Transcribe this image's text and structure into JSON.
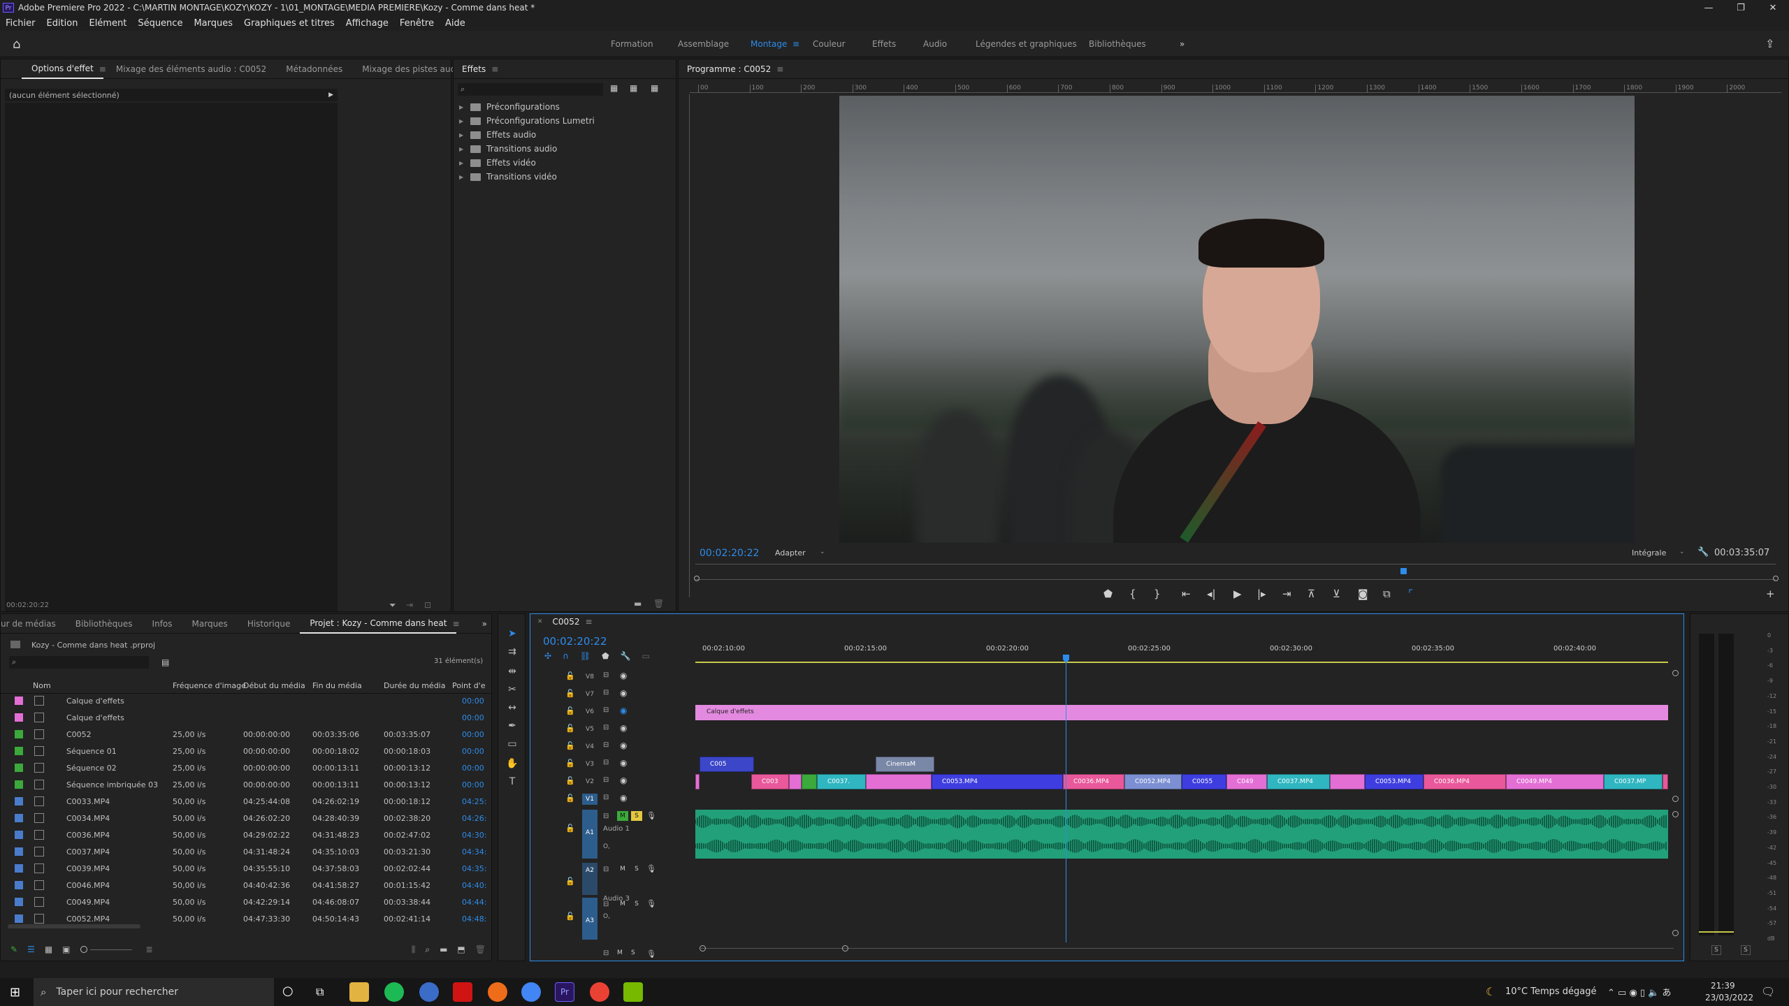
{
  "window": {
    "title": "Adobe Premiere Pro 2022 - C:\\MARTIN MONTAGE\\KOZY\\KOZY - 1\\01_MONTAGE\\MEDIA PREMIERE\\Kozy - Comme dans heat *",
    "app_icon": "Pr"
  },
  "menu": [
    "Fichier",
    "Edition",
    "Elément",
    "Séquence",
    "Marques",
    "Graphiques et titres",
    "Affichage",
    "Fenêtre",
    "Aide"
  ],
  "workspaces": [
    "Formation",
    "Assemblage",
    "Montage",
    "Couleur",
    "Effets",
    "Audio",
    "Légendes et graphiques",
    "Bibliothèques"
  ],
  "active_workspace": "Montage",
  "effect_controls": {
    "tabs": [
      "Options d'effet",
      "Mixage des éléments audio : C0052",
      "Métadonnées",
      "Mixage des pistes audio"
    ],
    "no_selection": "(aucun élément sélectionné)",
    "timecode": "00:02:20:22"
  },
  "effects": {
    "title": "Effets",
    "tree": [
      "Préconfigurations",
      "Préconfigurations Lumetri",
      "Effets audio",
      "Transitions audio",
      "Effets vidéo",
      "Transitions vidéo"
    ]
  },
  "program": {
    "title": "Programme : C0052",
    "timecode": "00:02:20:22",
    "fit": "Adapter",
    "quality": "Intégrale",
    "duration": "00:03:35:07",
    "ruler": [
      "00",
      "100",
      "200",
      "300",
      "400",
      "500",
      "600",
      "700",
      "800",
      "900",
      "1000",
      "1100",
      "1200",
      "1300",
      "1400",
      "1500",
      "1600",
      "1700",
      "1800",
      "1900",
      "2000"
    ]
  },
  "project": {
    "tabs": [
      "ur de médias",
      "Bibliothèques",
      "Infos",
      "Marques",
      "Historique",
      "Projet : Kozy - Comme dans heat"
    ],
    "file": "Kozy - Comme dans heat .prproj",
    "count": "31 élément(s)",
    "columns": [
      "Nom",
      "Fréquence d'image",
      "Début du média",
      "Fin du média",
      "Durée du média",
      "Point d'e"
    ],
    "rows": [
      {
        "name": "Calque d'effets",
        "fps": "",
        "start": "",
        "end": "",
        "dur": "",
        "inp": "00:00",
        "color": "#e36fd5"
      },
      {
        "name": "Calque d'effets",
        "fps": "",
        "start": "",
        "end": "",
        "dur": "",
        "inp": "00:00",
        "color": "#e36fd5"
      },
      {
        "name": "C0052",
        "fps": "25,00 i/s",
        "start": "00:00:00:00",
        "end": "00:03:35:06",
        "dur": "00:03:35:07",
        "inp": "00:00",
        "color": "#3ba93b"
      },
      {
        "name": "Séquence 01",
        "fps": "25,00 i/s",
        "start": "00:00:00:00",
        "end": "00:00:18:02",
        "dur": "00:00:18:03",
        "inp": "00:00",
        "color": "#3ba93b"
      },
      {
        "name": "Séquence 02",
        "fps": "25,00 i/s",
        "start": "00:00:00:00",
        "end": "00:00:13:11",
        "dur": "00:00:13:12",
        "inp": "00:00",
        "color": "#3ba93b"
      },
      {
        "name": "Séquence imbriquée 03",
        "fps": "25,00 i/s",
        "start": "00:00:00:00",
        "end": "00:00:13:11",
        "dur": "00:00:13:12",
        "inp": "00:00",
        "color": "#3ba93b"
      },
      {
        "name": "C0033.MP4",
        "fps": "50,00 i/s",
        "start": "04:25:44:08",
        "end": "04:26:02:19",
        "dur": "00:00:18:12",
        "inp": "04:25:",
        "color": "#4a7ccc"
      },
      {
        "name": "C0034.MP4",
        "fps": "50,00 i/s",
        "start": "04:26:02:20",
        "end": "04:28:40:39",
        "dur": "00:02:38:20",
        "inp": "04:26:",
        "color": "#4a7ccc"
      },
      {
        "name": "C0036.MP4",
        "fps": "50,00 i/s",
        "start": "04:29:02:22",
        "end": "04:31:48:23",
        "dur": "00:02:47:02",
        "inp": "04:30:",
        "color": "#4a7ccc"
      },
      {
        "name": "C0037.MP4",
        "fps": "50,00 i/s",
        "start": "04:31:48:24",
        "end": "04:35:10:03",
        "dur": "00:03:21:30",
        "inp": "04:34:",
        "color": "#4a7ccc"
      },
      {
        "name": "C0039.MP4",
        "fps": "50,00 i/s",
        "start": "04:35:55:10",
        "end": "04:37:58:03",
        "dur": "00:02:02:44",
        "inp": "04:35:",
        "color": "#4a7ccc"
      },
      {
        "name": "C0046.MP4",
        "fps": "50,00 i/s",
        "start": "04:40:42:36",
        "end": "04:41:58:27",
        "dur": "00:01:15:42",
        "inp": "04:40:",
        "color": "#4a7ccc"
      },
      {
        "name": "C0049.MP4",
        "fps": "50,00 i/s",
        "start": "04:42:29:14",
        "end": "04:46:08:07",
        "dur": "00:03:38:44",
        "inp": "04:44:",
        "color": "#4a7ccc"
      },
      {
        "name": "C0052.MP4",
        "fps": "50,00 i/s",
        "start": "04:47:33:30",
        "end": "04:50:14:43",
        "dur": "00:02:41:14",
        "inp": "04:48:",
        "color": "#4a7ccc"
      }
    ]
  },
  "timeline": {
    "tab": "C0052",
    "timecode": "00:02:20:22",
    "ruler": [
      "00:02:10:00",
      "00:02:15:00",
      "00:02:20:00",
      "00:02:25:00",
      "00:02:30:00",
      "00:02:35:00",
      "00:02:40:00"
    ],
    "video_tracks": [
      "V8",
      "V7",
      "V6",
      "V5",
      "V4",
      "V3",
      "V2",
      "V1"
    ],
    "audio_tracks": [
      "A1",
      "A2",
      "A3"
    ],
    "audio_names": [
      "Audio 1",
      "Audio 3"
    ],
    "track_buttons": {
      "mute": "M",
      "solo": "S",
      "sync": "O,"
    },
    "clips_v6": "Calque d'effets",
    "clips_v3": [
      "C005",
      "CinemaM"
    ],
    "clips_v2": [
      "C003",
      "C0037.",
      "C0053.MP4",
      "C0036.MP4",
      "C0052.MP4",
      "C0055",
      "C049",
      "C0037.MP4",
      "C0053.MP4",
      "C0036.MP4",
      "C0049.MP4",
      "C0037.MP"
    ]
  },
  "meter": {
    "scale": [
      "0",
      "-3",
      "-6",
      "-9",
      "-12",
      "-15",
      "-18",
      "-21",
      "-24",
      "-27",
      "-30",
      "-33",
      "-36",
      "-39",
      "-42",
      "-45",
      "-48",
      "-51",
      "-54",
      "-57",
      "dB"
    ],
    "solo": "S"
  },
  "taskbar": {
    "search": "Taper ici pour rechercher",
    "weather": "10°C  Temps dégagé",
    "time": "21:39",
    "date": "23/03/2022",
    "apps": [
      "Pr"
    ]
  }
}
